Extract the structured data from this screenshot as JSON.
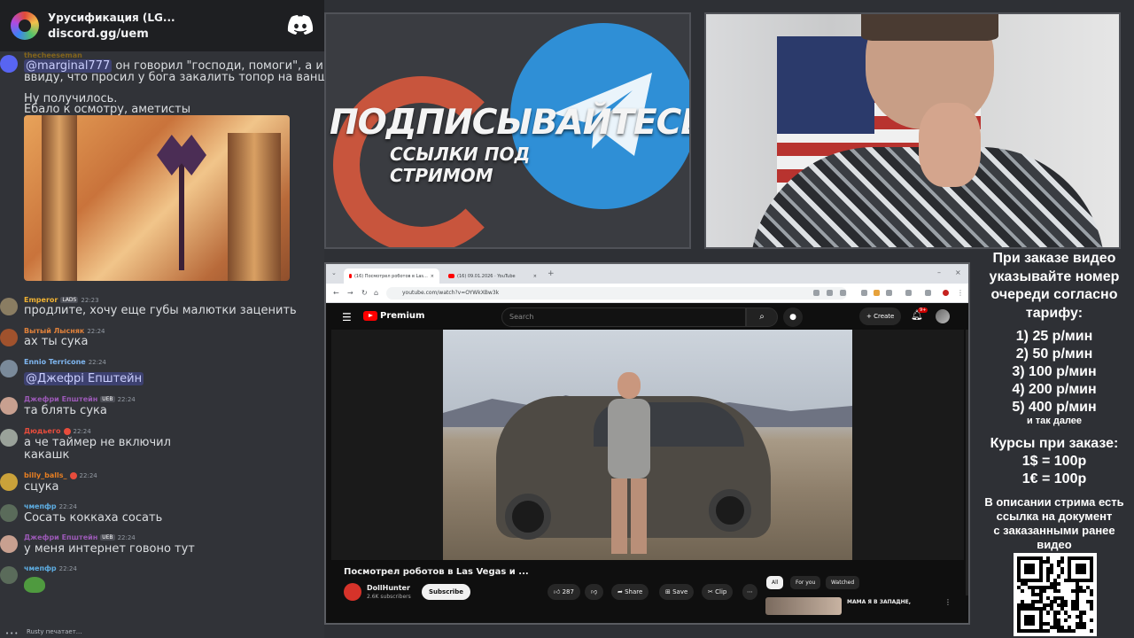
{
  "discord": {
    "server_name": "Урусификация (LG...",
    "invite": "discord.gg/uem",
    "messages": [
      {
        "type": "reply",
        "user": "thecheeseman",
        "text_mention": "@marginal777",
        "text_rest": " он говорил \"господи, помоги\", а имел",
        "text_line2": "ввиду, что просил у бога закалить топор на ваншот."
      },
      {
        "type": "plain",
        "line1": "Ну получилось.",
        "line2": "Ебало к осмотру, аметисты"
      },
      {
        "user": "Emperor",
        "tag": "LADS",
        "time": "22:23",
        "text": "продлите, хочу еще губы малютки заценить",
        "color": "#f0b232"
      },
      {
        "user": "Вытый Лысняк",
        "time": "22:24",
        "text": "ах ты сука",
        "color": "#e0813a"
      },
      {
        "user": "Ennio Terricone",
        "time": "22:24",
        "text": "@Джефрі Епштейн",
        "color": "#7fb6f0"
      },
      {
        "user": "Джефри Епштейн",
        "tag": "UEB",
        "time": "22:24",
        "text": "та блять сука",
        "color": "#9b59b6"
      },
      {
        "user": "Дюдьего",
        "time": "22:24",
        "line1": "а че таймер не включил",
        "line2": "какашк",
        "color": "#e74c3c"
      },
      {
        "user": "billy_balls_",
        "time": "22:24",
        "text": "сцука",
        "color": "#e67e22"
      },
      {
        "user": "чмепфр",
        "time": "22:24",
        "text": "Сосать коккаха сосать",
        "color": "#5dade2"
      },
      {
        "user": "Джефри Епштейн",
        "tag": "UEB",
        "time": "22:24",
        "text": "у меня интернет говоно тут",
        "color": "#9b59b6"
      },
      {
        "user": "чмепфр",
        "time": "22:24",
        "text": "",
        "color": "#5dade2"
      }
    ],
    "typing": "Rusty печатает..."
  },
  "promo": {
    "title": "ПОДПИСЫВАЙТЕСЬ",
    "subtitle": "ССЫЛКИ ПОД СТРИМОМ"
  },
  "browser": {
    "tabs": [
      {
        "label": "(16) Посмотрел роботов в Las..."
      },
      {
        "label": "(16) 09.01.2026 · YouTube"
      }
    ],
    "url": "youtube.com/watch?v=OYWkXBw3k",
    "search_placeholder": "Search",
    "logo_text": "Premium",
    "create_label": "Create",
    "bell_badge": "9+",
    "video_title": "Посмотрел роботов в Las Vegas и ...",
    "channel_name": "DollHunter",
    "channel_subs": "2.6K subscribers",
    "subscribe_label": "Subscribe",
    "likes": "287",
    "share_label": "Share",
    "save_label": "Save",
    "clip_label": "Clip",
    "chips": [
      "All",
      "For you",
      "Watched"
    ],
    "rec_title": "МАМА Я В ЗАПАДНЕ,"
  },
  "info": {
    "head": [
      "При заказе видео",
      "указывайте номер",
      "очереди согласно",
      "тарифу:"
    ],
    "prices": [
      "1) 25 р/мин",
      "2) 50 р/мин",
      "3) 100 р/мин",
      "4) 200 р/мин",
      "5) 400 р/мин"
    ],
    "more": "и так далее",
    "rates": [
      "Курсы при заказе:",
      "1$ = 100р",
      "1€ = 100р"
    ],
    "desc": [
      "В описании стрима есть",
      "ссылка на документ",
      "с заказанными ранее",
      "видео"
    ]
  }
}
